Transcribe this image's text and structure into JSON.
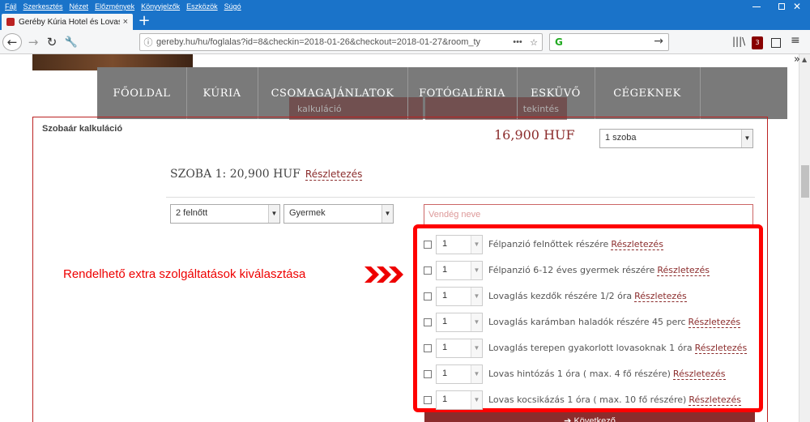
{
  "browser": {
    "menu": [
      "Fájl",
      "Szerkesztés",
      "Nézet",
      "Előzmények",
      "Könyvjelzők",
      "Eszközök",
      "Súgó"
    ],
    "tab_title": "Geréby Kúria Hotel és Lovasudvar",
    "tab_close": "×",
    "new_tab": "+",
    "url": "gereby.hu/hu/foglalas?id=8&checkin=2018-01-26&checkout=2018-01-27&room_ty",
    "url_info_icon": "ⓘ",
    "url_more_icon": "•••",
    "bookmark_icon": "☆",
    "search_go": "→",
    "back": "←",
    "forward": "→",
    "reload": "↻",
    "tools": "🔧",
    "library": "|||\\",
    "addon_badge": "3",
    "hamburger": "≡",
    "overflow": "»",
    "search_engine_glyph": "G"
  },
  "nav": {
    "items": [
      "FŐOLDAL",
      "KÚRIA",
      "CSOMAGAJÁNLATOK",
      "FOTÓGALÉRIA",
      "ESKÜVŐ",
      "CÉGEKNEK"
    ],
    "ghost_left": "kalkuláció",
    "ghost_right": "tekintés"
  },
  "calc": {
    "title": "Szobaár kalkuláció",
    "total_price": "16,900 HUF",
    "rooms_select": "1 szoba",
    "room_line": "SZOBA 1: 20,900 HUF",
    "details_link": "Részletezés",
    "adults_select": "2 felnőtt",
    "kids_select": "Gyermek",
    "guest_placeholder": "Vendég neve",
    "select_arrow": "▼"
  },
  "extras": {
    "annotation": "Rendelhető extra szolgáltatások kiválasztása",
    "items": [
      {
        "qty": "1",
        "label": "Félpanzió felnőttek részére",
        "link": "Részletezés"
      },
      {
        "qty": "1",
        "label": "Félpanzió 6-12 éves gyermek részére",
        "link": "Részletezés"
      },
      {
        "qty": "1",
        "label": "Lovaglás kezdők részére 1/2 óra",
        "link": "Részletezés"
      },
      {
        "qty": "1",
        "label": "Lovaglás karámban haladók részére 45 perc",
        "link": "Részletezés"
      },
      {
        "qty": "1",
        "label": "Lovaglás terepen gyakorlott lovasoknak 1 óra",
        "link": "Részletezés"
      },
      {
        "qty": "1",
        "label": "Lovas hintózás 1 óra ( max. 4 fő részére)",
        "link": "Részletezés"
      },
      {
        "qty": "1",
        "label": "Lovas kocsikázás 1 óra ( max. 10 fő részére)",
        "link": "Részletezés"
      }
    ]
  },
  "next_button": "➔ Következő",
  "colors": {
    "accent": "#8b2c2c",
    "chrome": "#1a73c9",
    "highlight": "#ff0000",
    "nav": "#7a7a7a"
  }
}
